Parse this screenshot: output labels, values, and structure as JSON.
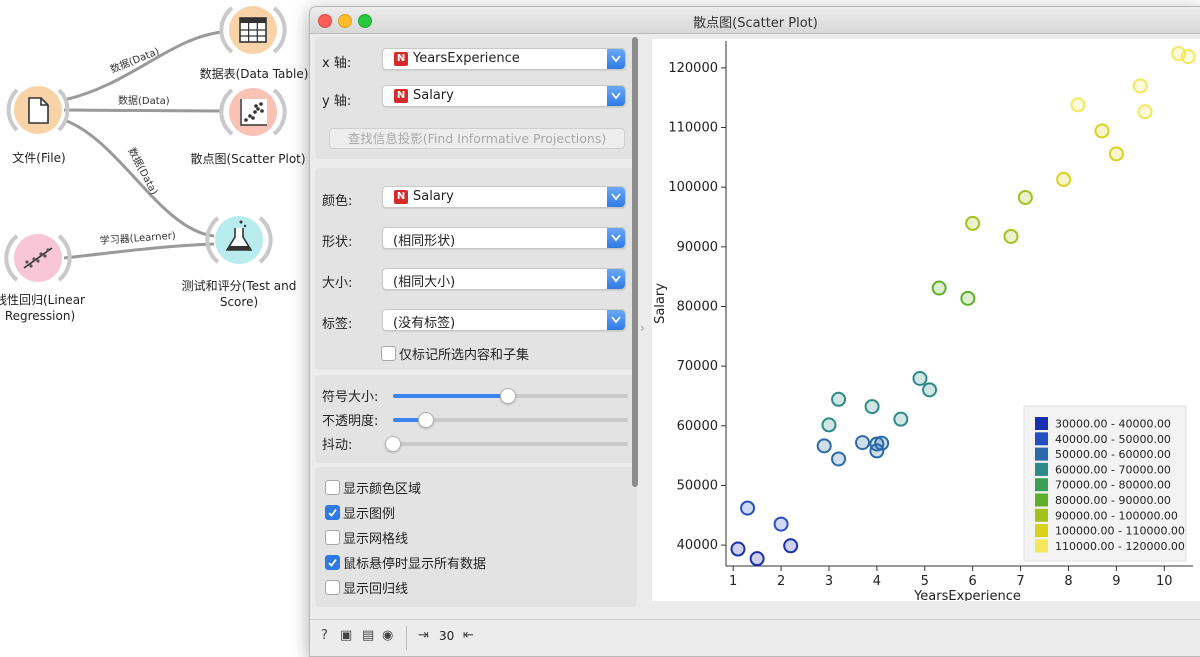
{
  "canvas": {
    "nodes": [
      {
        "id": "file",
        "label": "文件(File)",
        "color": "#f9d3a8",
        "ring": "#f0b777",
        "icon": "file-icon"
      },
      {
        "id": "datatable",
        "label": "数据表(Data Table)",
        "color": "#f9d3a8",
        "ring": "#f0b777",
        "icon": "table-icon"
      },
      {
        "id": "scatter",
        "label": "散点图(Scatter Plot)",
        "color": "#f9c2b4",
        "ring": "#f2a08c",
        "icon": "scatter-icon"
      },
      {
        "id": "testscore",
        "label_line1": "测试和评分(Test and",
        "label_line2": "Score)",
        "color": "#b9ecef",
        "ring": "#7fd7de",
        "icon": "flask-icon"
      },
      {
        "id": "linreg",
        "label_line1": "线性回归(Linear",
        "label_line2": "Regression)",
        "color": "#f8c6d7",
        "ring": "#ee9fbc",
        "icon": "regression-icon"
      }
    ],
    "links": [
      {
        "label": "数据(Data)"
      },
      {
        "label": "数据(Data)"
      },
      {
        "label": "数据(Data)"
      },
      {
        "label": "学习器(Learner)"
      }
    ]
  },
  "window": {
    "title": "散点图(Scatter Plot)",
    "controls": {
      "x_axis": {
        "label": "x 轴:",
        "value": "YearsExperience",
        "badge": "N"
      },
      "y_axis": {
        "label": "y 轴:",
        "value": "Salary",
        "badge": "N"
      },
      "find_projections": "查找信息投影(Find Informative Projections)",
      "color": {
        "label": "颜色:",
        "value": "Salary",
        "badge": "N"
      },
      "shape": {
        "label": "形状:",
        "value": "(相同形状)"
      },
      "size": {
        "label": "大小:",
        "value": "(相同大小)"
      },
      "label": {
        "label": "标签:",
        "value": "(没有标签)"
      },
      "label_only_selected": {
        "label": "仅标记所选内容和子集",
        "checked": false
      },
      "symbol_size": {
        "label": "符号大小:",
        "value": 0.49
      },
      "opacity": {
        "label": "不透明度:",
        "value": 0.14
      },
      "jitter": {
        "label": "抖动:",
        "value": 0.0
      },
      "checkboxes": [
        {
          "label": "显示颜色区域",
          "checked": false
        },
        {
          "label": "显示图例",
          "checked": true
        },
        {
          "label": "显示网格线",
          "checked": false
        },
        {
          "label": "鼠标悬停时显示所有数据",
          "checked": true
        },
        {
          "label": "显示回归线",
          "checked": false
        }
      ]
    },
    "status": {
      "count": "30"
    }
  },
  "chart_data": {
    "type": "scatter",
    "xlabel": "YearsExperience",
    "ylabel": "Salary",
    "xlim": [
      0.85,
      10.6
    ],
    "ylim": [
      36500,
      124500
    ],
    "xticks": [
      1,
      2,
      3,
      4,
      5,
      6,
      7,
      8,
      9,
      10
    ],
    "yticks": [
      40000,
      50000,
      60000,
      70000,
      80000,
      90000,
      100000,
      110000,
      120000
    ],
    "x": [
      1.1,
      1.3,
      1.5,
      2.0,
      2.2,
      2.9,
      3.0,
      3.2,
      3.2,
      3.7,
      3.9,
      4.0,
      4.0,
      4.1,
      4.5,
      4.9,
      5.1,
      5.3,
      5.9,
      6.0,
      6.8,
      7.1,
      7.9,
      8.2,
      8.7,
      9.0,
      9.5,
      9.6,
      10.3,
      10.5
    ],
    "y": [
      39343,
      46205,
      37731,
      43525,
      39891,
      56642,
      60150,
      54445,
      64445,
      57189,
      63218,
      55794,
      56957,
      57081,
      61111,
      67938,
      66029,
      83088,
      81363,
      93940,
      91738,
      98273,
      101302,
      113812,
      109431,
      105582,
      116969,
      112635,
      122391,
      121872
    ],
    "legend": [
      {
        "label": "30000.00 - 40000.00",
        "color": "#1a2fb0"
      },
      {
        "label": "40000.00 - 50000.00",
        "color": "#2450c2"
      },
      {
        "label": "50000.00 - 60000.00",
        "color": "#2a6aa8"
      },
      {
        "label": "60000.00 - 70000.00",
        "color": "#2e8a88"
      },
      {
        "label": "70000.00 - 80000.00",
        "color": "#3a9f55"
      },
      {
        "label": "80000.00 - 90000.00",
        "color": "#5fae2a"
      },
      {
        "label": "90000.00 - 100000.00",
        "color": "#a4c11c"
      },
      {
        "label": "100000.00 - 110000.00",
        "color": "#d8d21c"
      },
      {
        "label": "110000.00 - 120000.00",
        "color": "#f3e85c"
      }
    ],
    "legend_position": "bottom-right",
    "grid": false
  }
}
